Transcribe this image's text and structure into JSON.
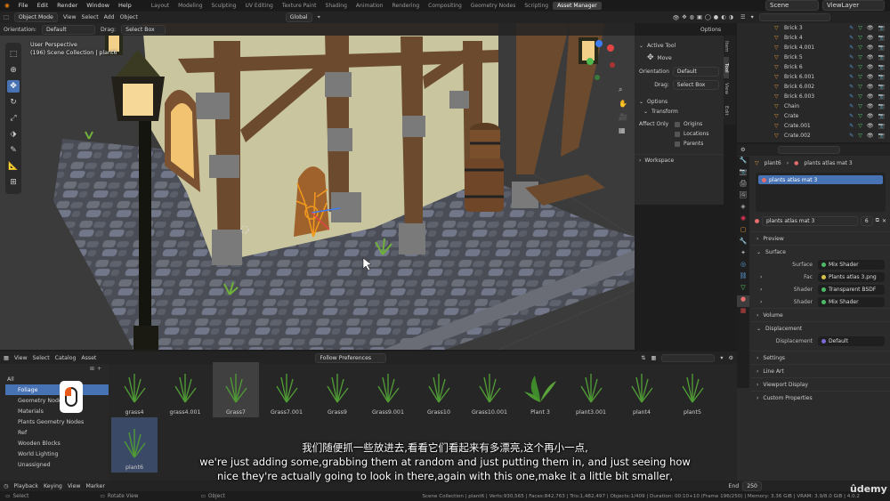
{
  "menubar": {
    "menus": [
      "File",
      "Edit",
      "Render",
      "Window",
      "Help"
    ],
    "workspaces": [
      "Layout",
      "Modeling",
      "Sculpting",
      "UV Editing",
      "Texture Paint",
      "Shading",
      "Animation",
      "Rendering",
      "Compositing",
      "Geometry Nodes",
      "Scripting",
      "Asset Manager"
    ],
    "active_workspace": "Asset Manager",
    "scene": "Scene",
    "view_layer": "ViewLayer"
  },
  "viewport_header": {
    "mode": "Object Mode",
    "menus": [
      "View",
      "Select",
      "Add",
      "Object"
    ],
    "transform": "Global",
    "orientation_label": "Orientation:",
    "orientation": "Default",
    "drag_label": "Drag:",
    "drag": "Select Box",
    "options": "Options"
  },
  "viewport_info": {
    "perspective": "User Perspective",
    "collection": "(196) Scene Collection | plant6"
  },
  "tool_panel": {
    "active_tool_title": "Active Tool",
    "tool_name": "Move",
    "orientation_label": "Orientation",
    "orientation_value": "Default",
    "drag_label": "Drag:",
    "drag_value": "Select Box",
    "options_title": "Options",
    "transform_title": "Transform",
    "affect_only": "Affect Only",
    "checks": [
      "Origins",
      "Locations",
      "Parents"
    ],
    "workspace_title": "Workspace",
    "tabs": [
      "Item",
      "Tool",
      "View",
      "Edit"
    ]
  },
  "outliner": {
    "search_placeholder": "",
    "items": [
      "Brick 3",
      "Brick 4",
      "Brick 4.001",
      "Brick 5",
      "Brick 6",
      "Brick 6.001",
      "Brick 6.002",
      "Brick 6.003",
      "Chain",
      "Crate",
      "Crate.001",
      "Crate.002"
    ]
  },
  "properties": {
    "object_name": "plant6",
    "material_name": "plants atlas mat 3",
    "slot_name": "plants atlas mat 3",
    "material_field": "plants atlas mat 3",
    "users": "6",
    "sections": {
      "preview": "Preview",
      "surface": "Surface",
      "volume": "Volume",
      "displacement": "Displacement",
      "settings": "Settings",
      "line_art": "Line Art",
      "viewport_display": "Viewport Display",
      "custom_properties": "Custom Properties"
    },
    "surface_rows": [
      {
        "key": "Surface",
        "value": "Mix Shader",
        "color": "#4dbb6a"
      },
      {
        "key": "Fac",
        "value": "Plants atlas 3.png",
        "color": "#d8c34a"
      },
      {
        "key": "Shader",
        "value": "Transparent BSDF",
        "color": "#4dbb6a"
      },
      {
        "key": "Shader",
        "value": "Mix Shader",
        "color": "#4dbb6a"
      }
    ],
    "displacement_row": {
      "key": "Displacement",
      "value": "Default",
      "color": "#7a6bd6"
    }
  },
  "asset_browser": {
    "menus": [
      "View",
      "Select",
      "Catalog",
      "Asset"
    ],
    "library": "Follow Preferences",
    "categories": [
      "All",
      "Foliage",
      "Geometry Nodes",
      "Materials",
      "Plants Geometry Nodes",
      "Ref",
      "Wooden Blocks",
      "World Lighting",
      "Unassigned"
    ],
    "selected_category": "Foliage",
    "assets": [
      "grass4",
      "grass4.001",
      "Grass7",
      "Grass7.001",
      "Grass9",
      "Grass9.001",
      "Grass10",
      "Grass10.001",
      "Plant 3",
      "plant3.001",
      "plant4",
      "plant5",
      "plant6"
    ]
  },
  "timeline": {
    "menus": [
      "Playback",
      "Keying",
      "View",
      "Marker"
    ],
    "end_label": "End",
    "end_value": "250"
  },
  "statusbar": {
    "left": [
      "Select",
      "Rotate View",
      "Object"
    ],
    "stats": "Scene Collection | plant6 | Verts:930,565 | Faces:842,763 | Tris:1,482,497 | Objects:1/409 | Duration: 00:10+10 (Frame 196/250) | Memory: 3.36 GiB | VRAM: 3.9/8.0 GiB | 4.0.2"
  },
  "subtitles": {
    "chinese": "我们随便抓一些放进去,看看它们看起来有多漂亮,这个再小一点,",
    "english_line1": "we're just adding some,grabbing them at random and just putting them in, and just seeing how",
    "english_line2": "nice they're actually going to look in there,again with this one,make it a little bit smaller,"
  },
  "watermark": "ûdemy"
}
